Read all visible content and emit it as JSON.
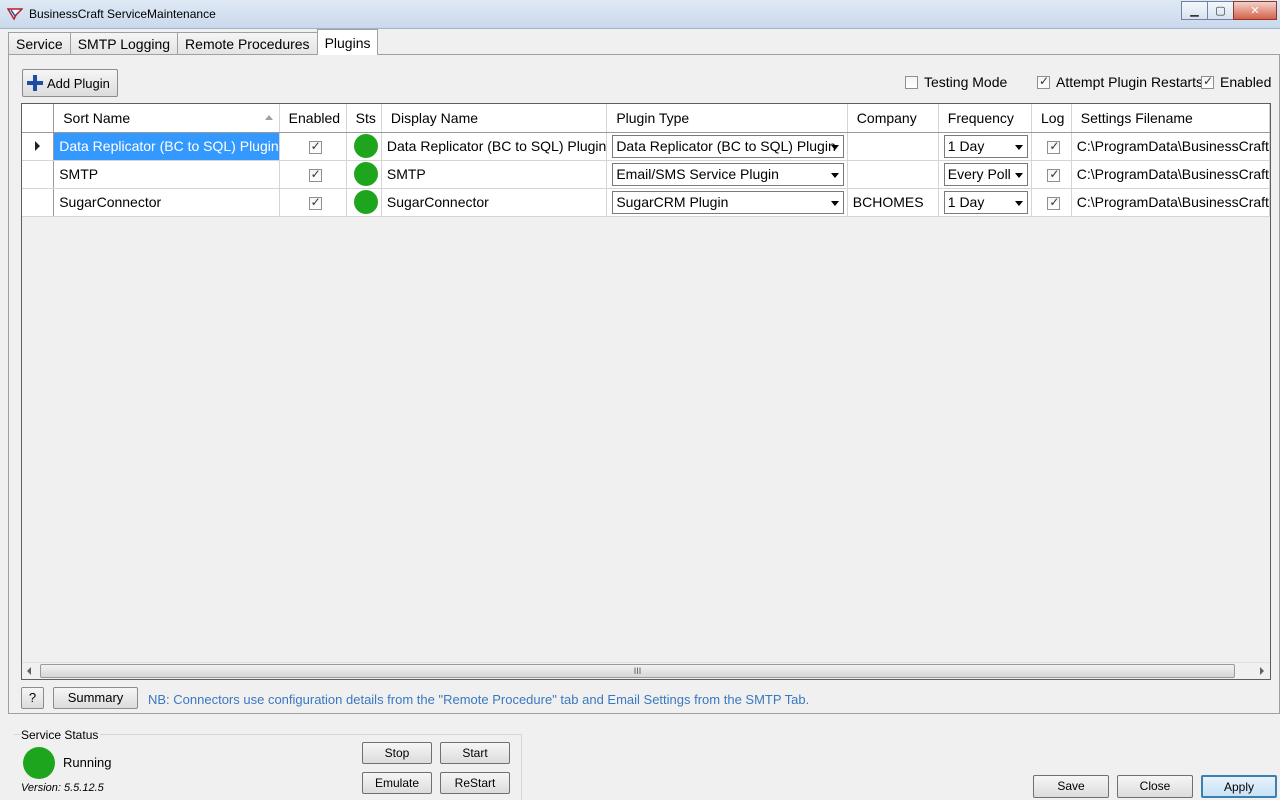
{
  "window": {
    "title": "BusinessCraft ServiceMaintenance",
    "controls": {
      "minimize": "▁",
      "maximize": "▢",
      "close": "✕"
    }
  },
  "tabs": [
    {
      "label": "Service",
      "active": false
    },
    {
      "label": "SMTP Logging",
      "active": false
    },
    {
      "label": "Remote Procedures",
      "active": false
    },
    {
      "label": "Plugins",
      "active": true
    }
  ],
  "toolbar": {
    "add_plugin_label": "Add Plugin",
    "testing_mode": {
      "label": "Testing Mode",
      "checked": false
    },
    "attempt_restarts": {
      "label": "Attempt Plugin Restarts",
      "checked": true
    },
    "enabled": {
      "label": "Enabled",
      "checked": true
    }
  },
  "grid": {
    "columns": [
      "Sort Name",
      "Enabled",
      "Sts",
      "Display Name",
      "Plugin Type",
      "Company",
      "Frequency",
      "Log",
      "Settings Filename"
    ],
    "rows": [
      {
        "sort_name": "Data Replicator (BC to SQL) Plugin",
        "enabled": true,
        "status": "running",
        "display_name": "Data Replicator (BC to SQL) Plugin",
        "plugin_type": "Data Replicator (BC to SQL) Plugin",
        "company": "",
        "frequency": "1 Day",
        "log": true,
        "settings_filename": "C:\\ProgramData\\BusinessCraft",
        "selected": true
      },
      {
        "sort_name": "SMTP",
        "enabled": true,
        "status": "running",
        "display_name": "SMTP",
        "plugin_type": "Email/SMS Service Plugin",
        "company": "",
        "frequency": "Every Poll",
        "log": true,
        "settings_filename": "C:\\ProgramData\\BusinessCraft",
        "selected": false
      },
      {
        "sort_name": "SugarConnector",
        "enabled": true,
        "status": "running",
        "display_name": "SugarConnector",
        "plugin_type": "SugarCRM Plugin",
        "company": "BCHOMES",
        "frequency": "1 Day",
        "log": true,
        "settings_filename": "C:\\ProgramData\\BusinessCraft",
        "selected": false
      }
    ],
    "scroll_thumb_grip": "III"
  },
  "footer": {
    "help_label": "?",
    "summary_label": "Summary",
    "note": "NB: Connectors use configuration details from the \"Remote Procedure\" tab and Email Settings from the SMTP Tab."
  },
  "service": {
    "group_label": "Service Status",
    "status_text": "Running",
    "version": "Version: 5.5.12.5",
    "stop_label": "Stop",
    "start_label": "Start",
    "emulate_label": "Emulate",
    "restart_label": "ReStart"
  },
  "dialog_buttons": {
    "save_label": "Save",
    "close_label": "Close",
    "apply_label": "Apply"
  },
  "colors": {
    "status_green": "#1ea51e",
    "selection_blue": "#3399ff",
    "note_blue": "#3a78c0"
  }
}
